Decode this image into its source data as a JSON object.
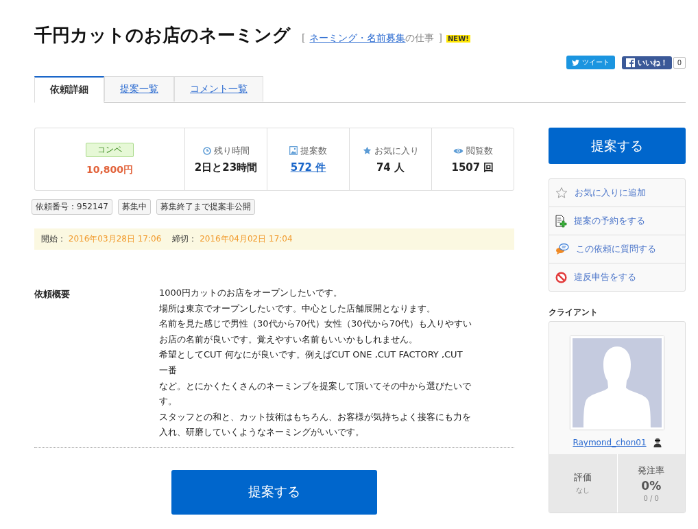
{
  "title": "千円カットのお店のネーミング",
  "category": {
    "open": "[",
    "link": "ネーミング・名前募集",
    "suffix": "の仕事",
    "close": "]",
    "badge": "NEW!"
  },
  "share": {
    "tweet": "ツイート",
    "like": "いいね！",
    "like_count": "0"
  },
  "tabs": [
    {
      "label": "依頼詳細",
      "selected": true
    },
    {
      "label": "提案一覧",
      "selected": false
    },
    {
      "label": "コメント一覧",
      "selected": false
    }
  ],
  "stats": [
    {
      "kind": "price",
      "badge": "コンペ",
      "value": "10,800円"
    },
    {
      "kind": "clock",
      "label": "残り時間",
      "value": "2日と23時間",
      "link": false
    },
    {
      "kind": "image",
      "label": "提案数",
      "value": "572 件",
      "link": true
    },
    {
      "kind": "star",
      "label": "お気に入り",
      "value": "74 人",
      "link": false
    },
    {
      "kind": "eye",
      "label": "閲覧数",
      "value": "1507 回",
      "link": false
    }
  ],
  "tags": [
    "依頼番号：952147",
    "募集中",
    "募集終了まで提案非公開"
  ],
  "period": {
    "start_label": "開始：",
    "start": "2016年03月28日 17:06",
    "end_label": "締切：",
    "end": "2016年04月02日 17:04"
  },
  "summary": {
    "label": "依頼概要",
    "lines": [
      "1000円カットのお店をオープンしたいです。",
      "場所は東京でオープンしたいです。中心とした店舗展開となります。",
      "名前を見た感じで男性（30代から70代）女性（30代から70代）も入りやすい",
      "お店の名前が良いです。覚えやすい名前もいいかもしれません。",
      "希望としてCUT 何なにが良いです。例えばCUT ONE ,CUT FACTORY ,CUT",
      "一番",
      "など。とにかくたくさんのネーミンブを提案して頂いてその中から選びたいで",
      "す。",
      "スタッフとの和と、カット技術はもちろん、お客様が気持ちよく接客にも力を",
      "入れ、研磨していくようなネーミングがいいです。"
    ]
  },
  "propose_button": "提案する",
  "sidebar": {
    "propose_button": "提案する",
    "actions": [
      {
        "kind": "star",
        "label": "お気に入りに追加"
      },
      {
        "kind": "doc",
        "label": "提案の予約をする"
      },
      {
        "kind": "chat",
        "label": "この依頼に質問する"
      },
      {
        "kind": "ban",
        "label": "違反申告をする"
      }
    ],
    "client_heading": "クライアント",
    "client": {
      "name": "Raymond_chon01",
      "rating_label": "評価",
      "rating": "なし",
      "rate_label": "発注率",
      "rate": "0%",
      "rate_detail": "0 / 0"
    }
  }
}
